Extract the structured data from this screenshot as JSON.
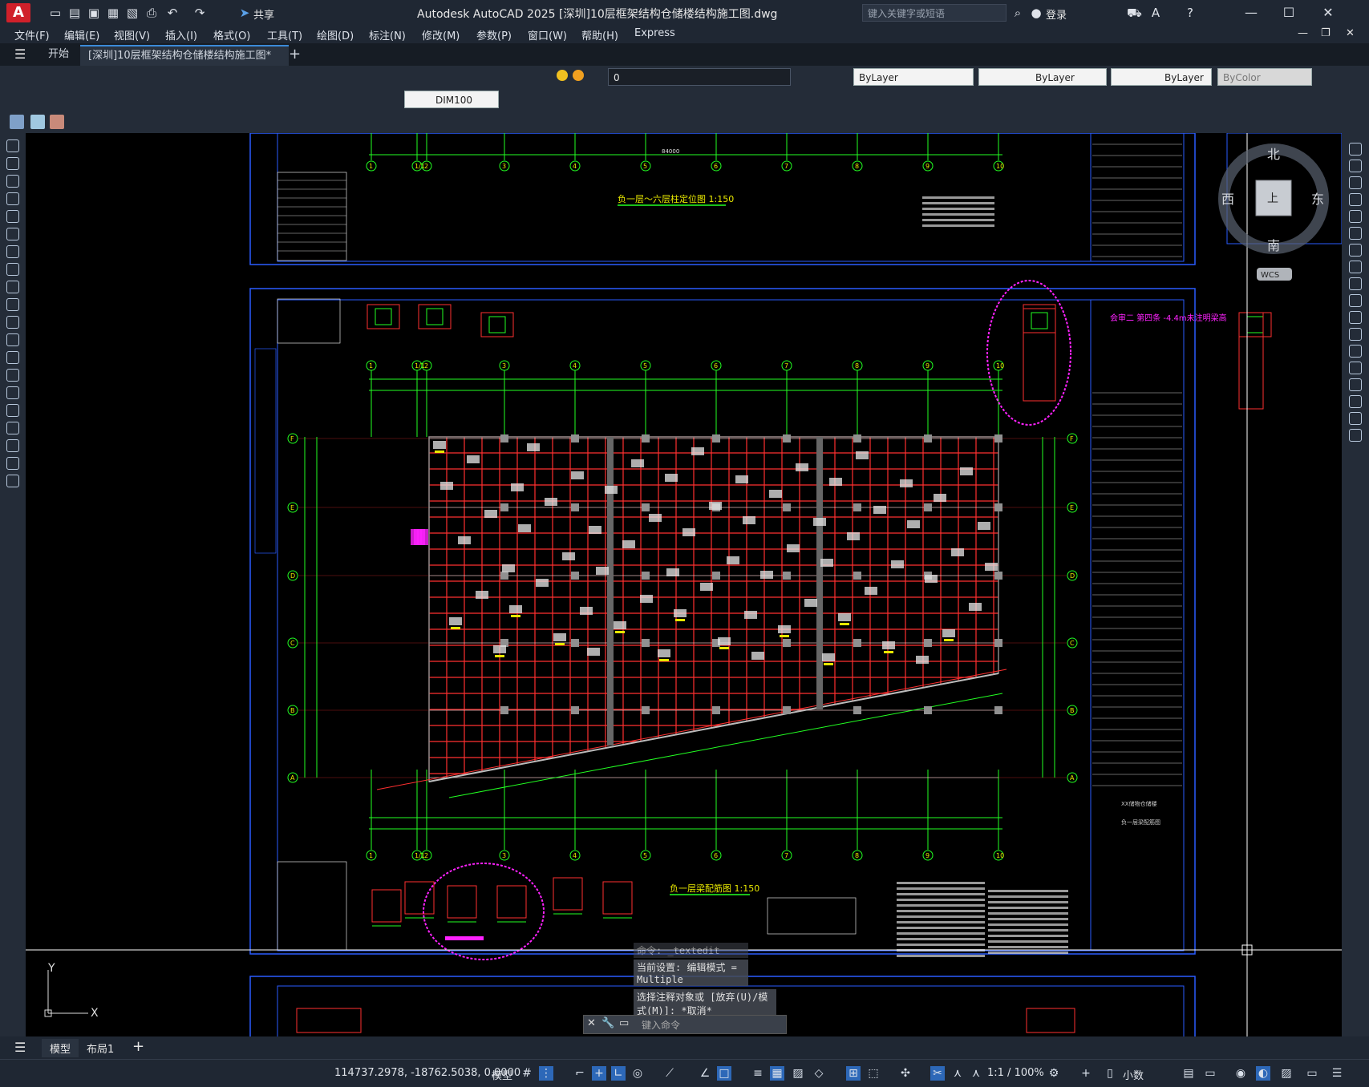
{
  "title_bar": {
    "app_logo": "A",
    "share_label": "共享",
    "window_title": "Autodesk AutoCAD 2025    [深圳]10层框架结构仓储楼结构施工图.dwg",
    "search_placeholder": "键入关键字或短语",
    "login_label": "登录"
  },
  "menu": [
    "文件(F)",
    "编辑(E)",
    "视图(V)",
    "插入(I)",
    "格式(O)",
    "工具(T)",
    "绘图(D)",
    "标注(N)",
    "修改(M)",
    "参数(P)",
    "窗口(W)",
    "帮助(H)",
    "Express"
  ],
  "tabs": {
    "start": "开始",
    "active": "[深圳]10层框架结构仓储楼结构施工图*"
  },
  "toolbar": {
    "layer_value": "0",
    "color_value": "ByLayer",
    "linetype_value": "ByLayer",
    "lineweight_value": "ByLayer",
    "plotstyle_value": "ByColor",
    "dimstyle_value": "DIM100"
  },
  "drawing": {
    "plan_top_title": "负一层～六层柱定位图 1:150",
    "plan_main_title": "负一层梁配筋图 1:150",
    "top_dim_total": "84000",
    "axis_numbers": [
      "1",
      "1/1",
      "2",
      "3",
      "4",
      "5",
      "6",
      "7",
      "8",
      "9",
      "10"
    ],
    "axis_letters": [
      "F",
      "E",
      "D",
      "C",
      "B",
      "A"
    ],
    "annotation_magenta": "会审二 第四条 -4.4m未注明梁高",
    "compass": {
      "north": "北",
      "south": "南",
      "east": "东",
      "west": "西",
      "center": "上",
      "wcs": "WCS"
    },
    "title_block_project": "XX储物仓储楼",
    "title_block_sheet": "负一层梁配筋图",
    "ucs_x": "X",
    "ucs_y": "Y"
  },
  "command": {
    "line1": "命令: _textedit",
    "line2": "当前设置: 编辑模式 = Multiple",
    "line3": "选择注释对象或 [放弃(U)/模式(M)]: *取消*",
    "input_placeholder": "键入命令"
  },
  "layout_tabs": {
    "model": "模型",
    "layout1": "布局1"
  },
  "status": {
    "coords": "114737.2978, -18762.5038, 0.0000",
    "mode": "模型",
    "scale": "1:1 / 100%",
    "units": "小数"
  }
}
